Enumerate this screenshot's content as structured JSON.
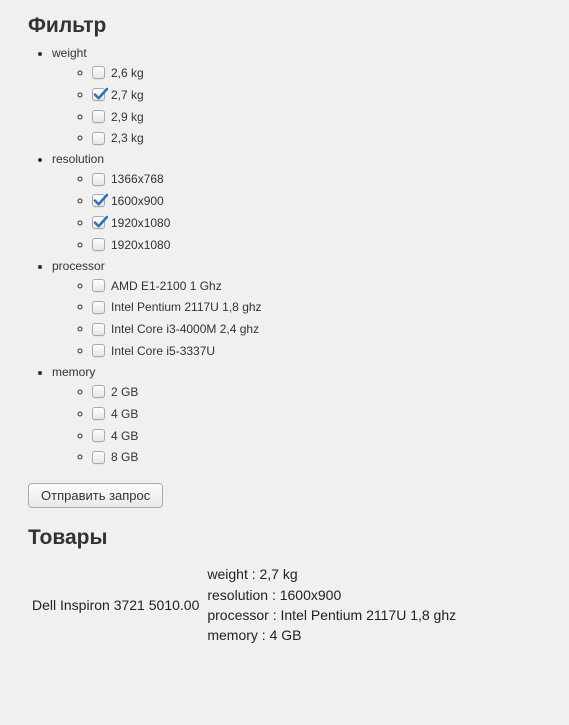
{
  "filter": {
    "heading": "Фильтр",
    "groups": [
      {
        "name": "weight",
        "options": [
          {
            "label": "2,6 kg",
            "checked": false
          },
          {
            "label": "2,7 kg",
            "checked": true
          },
          {
            "label": "2,9 kg",
            "checked": false
          },
          {
            "label": "2,3 kg",
            "checked": false
          }
        ]
      },
      {
        "name": "resolution",
        "options": [
          {
            "label": "1366x768",
            "checked": false
          },
          {
            "label": "1600x900",
            "checked": true
          },
          {
            "label": "1920x1080",
            "checked": true
          },
          {
            "label": "1920x1080",
            "checked": false
          }
        ]
      },
      {
        "name": "processor",
        "options": [
          {
            "label": "AMD E1-2100 1 Ghz",
            "checked": false
          },
          {
            "label": "Intel Pentium 2117U 1,8 ghz",
            "checked": false
          },
          {
            "label": "Intel Core i3-4000M 2,4 ghz",
            "checked": false
          },
          {
            "label": "Intel Core i5-3337U",
            "checked": false
          }
        ]
      },
      {
        "name": "memory",
        "options": [
          {
            "label": "2 GB",
            "checked": false
          },
          {
            "label": "4 GB",
            "checked": false
          },
          {
            "label": "4 GB",
            "checked": false
          },
          {
            "label": "8 GB",
            "checked": false
          }
        ]
      }
    ],
    "submit_label": "Отправить запрос"
  },
  "products": {
    "heading": "Товары",
    "items": [
      {
        "name": "Dell Inspiron 3721",
        "price": "5010.00",
        "specs": [
          {
            "key": "weight",
            "value": "2,7 kg"
          },
          {
            "key": "resolution",
            "value": "1600x900"
          },
          {
            "key": "processor",
            "value": "Intel Pentium 2117U 1,8 ghz"
          },
          {
            "key": "memory",
            "value": "4 GB"
          }
        ]
      }
    ]
  }
}
